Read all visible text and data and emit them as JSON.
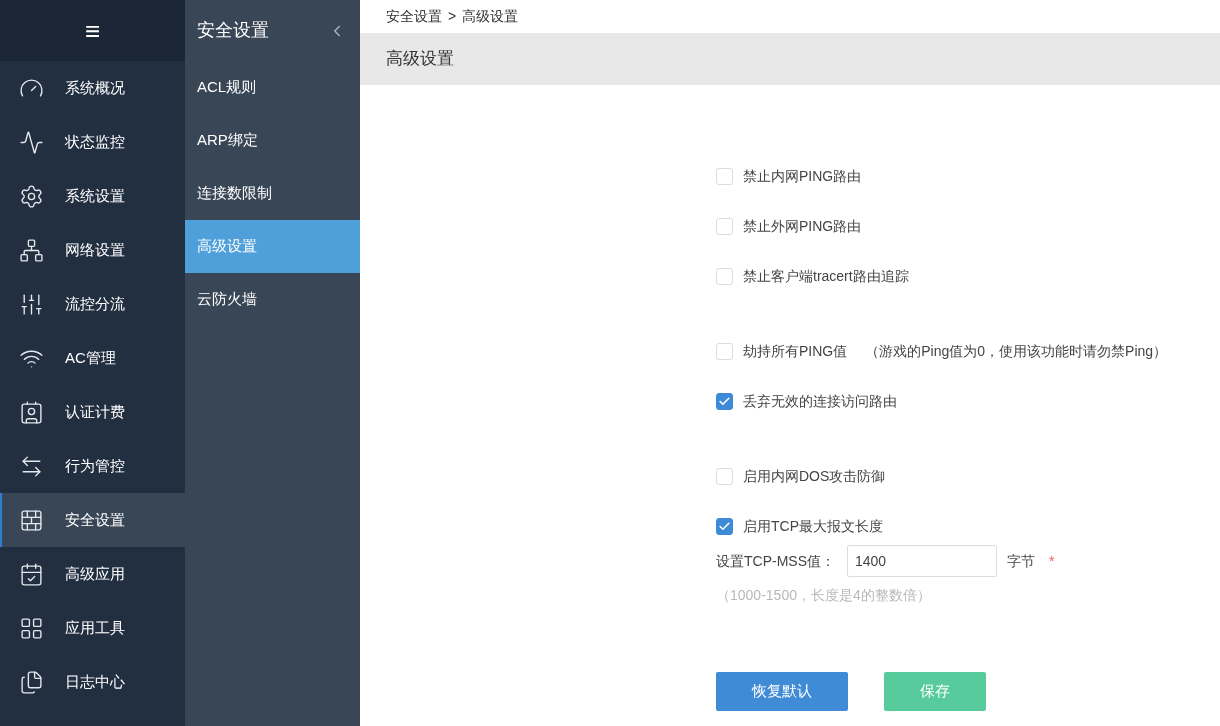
{
  "nav": {
    "menu_icon": "≡",
    "items": [
      {
        "label": "系统概况",
        "selected": false
      },
      {
        "label": "状态监控",
        "selected": false
      },
      {
        "label": "系统设置",
        "selected": false
      },
      {
        "label": "网络设置",
        "selected": false
      },
      {
        "label": "流控分流",
        "selected": false
      },
      {
        "label": "AC管理",
        "selected": false
      },
      {
        "label": "认证计费",
        "selected": false
      },
      {
        "label": "行为管控",
        "selected": false
      },
      {
        "label": "安全设置",
        "selected": true
      },
      {
        "label": "高级应用",
        "selected": false
      },
      {
        "label": "应用工具",
        "selected": false
      },
      {
        "label": "日志中心",
        "selected": false
      }
    ]
  },
  "submenu": {
    "title": "安全设置",
    "items": [
      {
        "label": "ACL规则",
        "selected": false
      },
      {
        "label": "ARP绑定",
        "selected": false
      },
      {
        "label": "连接数限制",
        "selected": false
      },
      {
        "label": "高级设置",
        "selected": true
      },
      {
        "label": "云防火墙",
        "selected": false
      }
    ]
  },
  "breadcrumb": [
    "安全设置",
    "高级设置"
  ],
  "breadcrumb_separator": ">",
  "page_title": "高级设置",
  "option_groups": [
    [
      {
        "label": "禁止内网PING路由",
        "checked": false
      },
      {
        "label": "禁止外网PING路由",
        "checked": false
      },
      {
        "label": "禁止客户端tracert路由追踪",
        "checked": false
      }
    ],
    [
      {
        "label": "劫持所有PING值",
        "note": "（游戏的Ping值为0，使用该功能时请勿禁Ping）",
        "checked": false
      },
      {
        "label": "丢弃无效的连接访问路由",
        "checked": true
      }
    ],
    [
      {
        "label": "启用内网DOS攻击防御",
        "checked": false
      },
      {
        "label": "启用TCP最大报文长度",
        "checked": true
      }
    ]
  ],
  "mss": {
    "label": "设置TCP-MSS值：",
    "value": "1400",
    "unit": "字节",
    "required_mark": "*",
    "hint": "（1000-1500，长度是4的整数倍）"
  },
  "buttons": [
    {
      "label": "恢复默认",
      "kind": "secondary"
    },
    {
      "label": "保存",
      "kind": "primary"
    }
  ]
}
